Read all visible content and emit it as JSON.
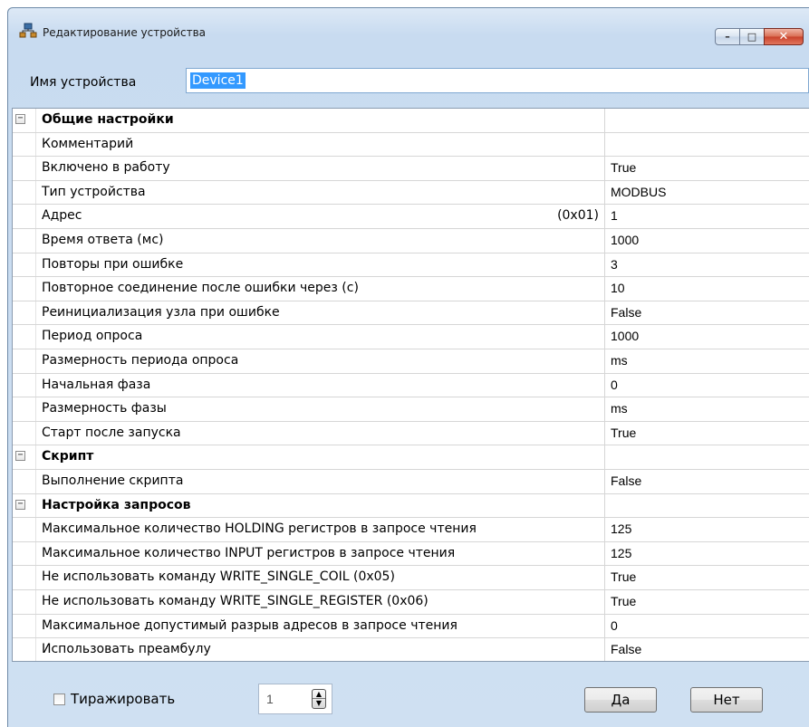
{
  "window": {
    "title": "Редактирование устройства",
    "icon": "app-network-icon",
    "buttons": {
      "minimize": "minimize-icon",
      "maximize": "maximize-icon",
      "close": "close-icon"
    }
  },
  "device_name": {
    "label": "Имя устройства",
    "value": "Device1"
  },
  "properties": [
    {
      "kind": "category",
      "name": "Общие настройки",
      "value": ""
    },
    {
      "kind": "prop",
      "name": "Комментарий",
      "value": ""
    },
    {
      "kind": "prop",
      "name": "Включено в работу",
      "value": "True"
    },
    {
      "kind": "prop",
      "name": "Тип устройства",
      "value": "MODBUS"
    },
    {
      "kind": "prop",
      "name": "Адрес",
      "hex": "(0x01)",
      "value": "1"
    },
    {
      "kind": "prop",
      "name": "Время ответа (мс)",
      "value": "1000"
    },
    {
      "kind": "prop",
      "name": "Повторы при ошибке",
      "value": "3"
    },
    {
      "kind": "prop",
      "name": "Повторное соединение после ошибки через (с)",
      "value": "10"
    },
    {
      "kind": "prop",
      "name": "Реинициализация узла при ошибке",
      "value": "False"
    },
    {
      "kind": "prop",
      "name": "Период опроса",
      "value": "1000"
    },
    {
      "kind": "prop",
      "name": "Размерность периода опроса",
      "value": "ms"
    },
    {
      "kind": "prop",
      "name": "Начальная фаза",
      "value": "0"
    },
    {
      "kind": "prop",
      "name": "Размерность фазы",
      "value": "ms"
    },
    {
      "kind": "prop",
      "name": "Старт после запуска",
      "value": "True"
    },
    {
      "kind": "category",
      "name": "Скрипт",
      "value": ""
    },
    {
      "kind": "prop",
      "name": "Выполнение скрипта",
      "value": "False"
    },
    {
      "kind": "category",
      "name": "Настройка запросов",
      "value": ""
    },
    {
      "kind": "prop",
      "name": "Максимальное количество HOLDING регистров в запросе чтения",
      "value": "125"
    },
    {
      "kind": "prop",
      "name": "Максимальное количество INPUT регистров в запросе чтения",
      "value": "125"
    },
    {
      "kind": "prop",
      "name": "Не использовать команду WRITE_SINGLE_COIL (0x05)",
      "value": "True"
    },
    {
      "kind": "prop",
      "name": "Не использовать команду WRITE_SINGLE_REGISTER (0x06)",
      "value": "True"
    },
    {
      "kind": "prop",
      "name": "Максимальное допустимый разрыв адресов в запросе чтения",
      "value": "0"
    },
    {
      "kind": "prop",
      "name": "Использовать преамбулу",
      "value": "False"
    }
  ],
  "footer": {
    "replicate_label": "Тиражировать",
    "replicate_checked": false,
    "count_value": "1",
    "ok_label": "Да",
    "cancel_label": "Нет"
  }
}
